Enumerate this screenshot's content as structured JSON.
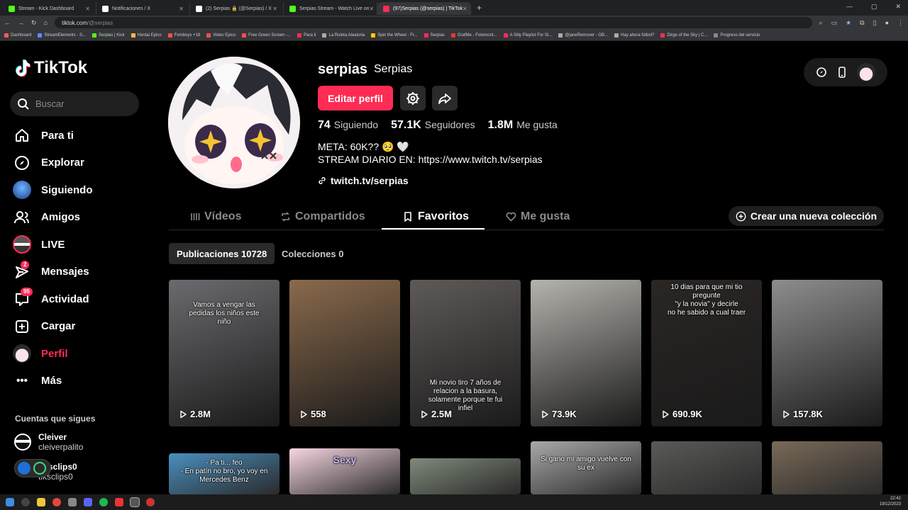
{
  "browser": {
    "tabs": [
      {
        "label": "Stream - Kick Dashboard",
        "color": "#53fc18",
        "active": false
      },
      {
        "label": "Notificaciones / X",
        "color": "#ffffff",
        "active": false
      },
      {
        "label": "(2) Serpias 🔒 (@Serpias) / X",
        "color": "#ffffff",
        "active": false
      },
      {
        "label": "Serpias Stream - Watch Live on",
        "color": "#53fc18",
        "active": false
      },
      {
        "label": "(97)Serpias (@serpias) | TikTok",
        "color": "#fe2c55",
        "active": true
      }
    ],
    "url_host": "tiktok.com",
    "url_path": "/@serpias",
    "bookmarks": [
      "Dashboard",
      "StreamElements - S...",
      "Serpias | Kick",
      "Hentai Epico",
      "Femboys +18",
      "Video Epico",
      "Free Green Screen -...",
      "Para ti",
      "La Ruleta Aleatoria",
      "Spin the Wheel - Fr...",
      "Serpias",
      "GrafMe - Fotomont...",
      "A Silly Playlist For Si...",
      "@janeRemover - OB...",
      "Hay ahora fútbol?",
      "Dirge of the Sky | C...",
      "Progreso del servicio"
    ]
  },
  "sidebar": {
    "logo_text": "TikTok",
    "search_placeholder": "Buscar",
    "nav": [
      {
        "label": "Para ti",
        "icon": "home-icon"
      },
      {
        "label": "Explorar",
        "icon": "compass-icon"
      },
      {
        "label": "Siguiendo",
        "icon": "following-avatar-icon"
      },
      {
        "label": "Amigos",
        "icon": "friends-icon"
      },
      {
        "label": "LIVE",
        "icon": "live-icon"
      },
      {
        "label": "Mensajes",
        "icon": "messages-icon",
        "badge": "2"
      },
      {
        "label": "Actividad",
        "icon": "activity-icon",
        "badge": "95"
      },
      {
        "label": "Cargar",
        "icon": "upload-icon"
      },
      {
        "label": "Perfil",
        "icon": "profile-avatar-icon",
        "active": true
      },
      {
        "label": "Más",
        "icon": "more-icon"
      }
    ],
    "following_title": "Cuentas que sigues",
    "accounts": [
      {
        "name": "Cleiver",
        "handle": "cleiverpalito"
      },
      {
        "name": "tiksclips0",
        "handle": "tiksclips0"
      }
    ]
  },
  "profile": {
    "username": "serpias",
    "nickname": "Serpias",
    "edit_label": "Editar perfil",
    "following_count": "74",
    "following_label": "Siguiendo",
    "followers_count": "57.1K",
    "followers_label": "Seguidores",
    "likes_count": "1.8M",
    "likes_label": "Me gusta",
    "bio_line1": "META: 60K?? 🥺 🤍",
    "bio_line2": "STREAM DIARIO EN: https://www.twitch.tv/serpias",
    "link": "twitch.tv/serpias"
  },
  "tabs": {
    "videos": "Vídeos",
    "shared": "Compartidos",
    "favorites": "Favoritos",
    "likes": "Me gusta",
    "new_collection": "Crear una nueva colección"
  },
  "chips": {
    "posts": "Publicaciones 10728",
    "collections": "Colecciones 0"
  },
  "videos": [
    {
      "views": "2.8M",
      "text": "Vamos a vengar las\npedidas los niños este\nniño",
      "bg": "#6b6a6e"
    },
    {
      "views": "558",
      "text": "",
      "bg": "#8a6a4c"
    },
    {
      "views": "2.5M",
      "text": "Mi novio tiro 7 años de\nrelacion a la basura,\nsolamente porque te fui\ninfiel",
      "bg": "#5e5a58"
    },
    {
      "views": "73.9K",
      "text": "",
      "bg": "#b5b3ad"
    },
    {
      "views": "690.9K",
      "text": "10 dias para que mi tio pregunte\n\"y la novia\" y decirle\nno he sabido a cual traer",
      "bg": "#2a2624"
    },
    {
      "views": "157.8K",
      "text": "",
      "bg": "#8d8d8d"
    }
  ],
  "videos_row2": [
    {
      "text": "- Pa ti... feo\n- En patín no bro, yo voy en\nMercedes Benz",
      "bg": "#4a8fbf"
    },
    {
      "text": "Sexy",
      "bg": "#f7d6e2"
    },
    {
      "text": "",
      "bg": "#7f8a7a"
    },
    {
      "text": "Si gano mi amigo vuelve con\nsu ex",
      "bg": "#a9a9a9"
    },
    {
      "text": "",
      "bg": "#5a5a58"
    },
    {
      "text": "",
      "bg": "#7a6a58"
    }
  ],
  "clock": {
    "time": "22:42",
    "date": "19/12/2023"
  }
}
